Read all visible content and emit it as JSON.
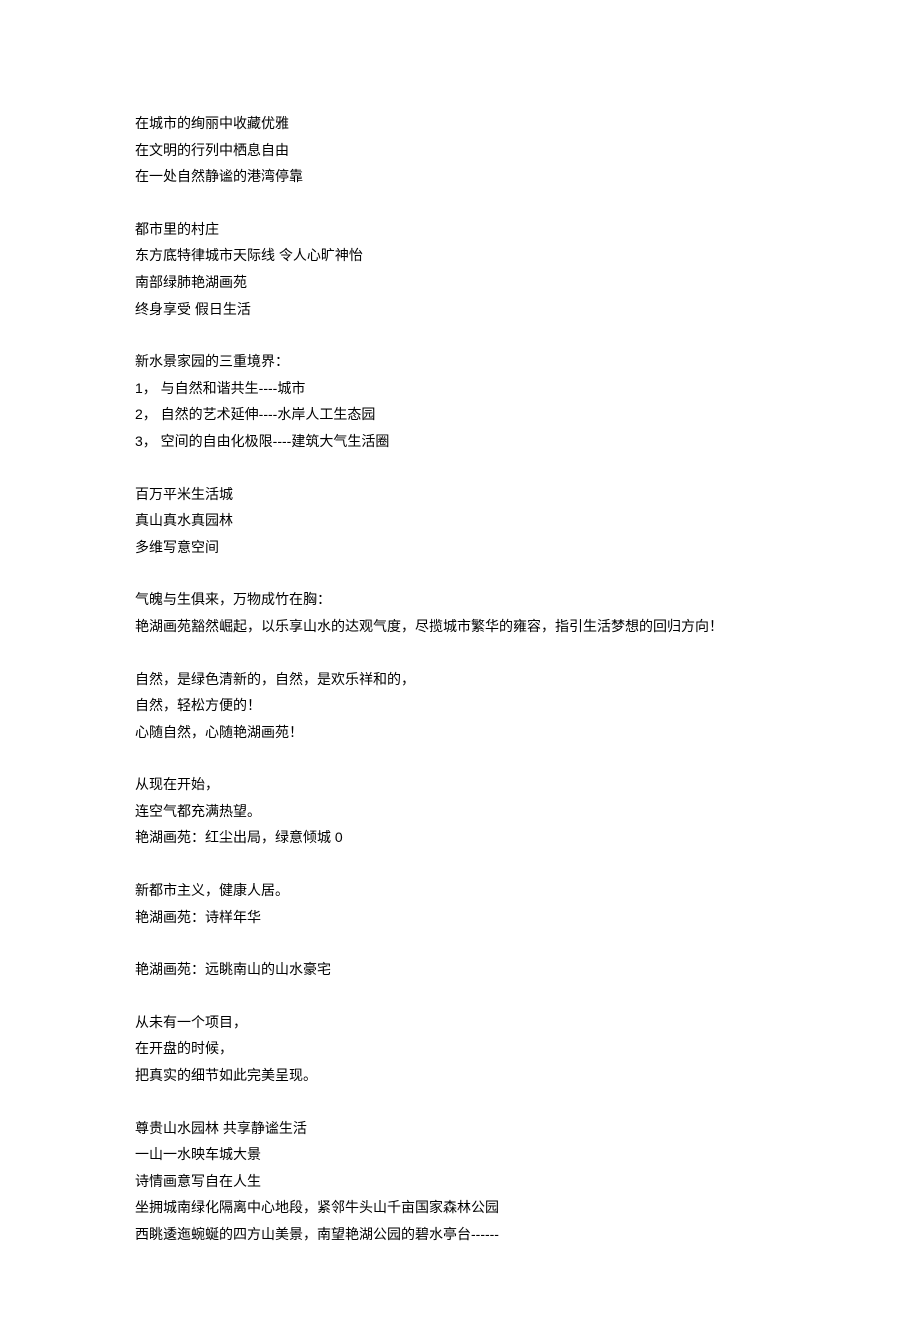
{
  "blocks": [
    {
      "lines": [
        "在城市的绚丽中收藏优雅",
        "在文明的行列中栖息自由",
        "在一处自然静谧的港湾停靠"
      ]
    },
    {
      "lines": [
        "都市里的村庄",
        "东方底特律城市天际线  令人心旷神怡",
        "南部绿肺艳湖画苑",
        "终身享受  假日生活"
      ]
    },
    {
      "lines": [
        "新水景家园的三重境界：",
        "1，   与自然和谐共生----城市",
        "2，   自然的艺术延伸----水岸人工生态园",
        "3，   空间的自由化极限----建筑大气生活圈"
      ]
    },
    {
      "lines": [
        "百万平米生活城",
        "真山真水真园林",
        "多维写意空间"
      ]
    },
    {
      "lines": [
        "气魄与生俱来，万物成竹在胸：",
        "艳湖画苑豁然崛起，以乐享山水的达观气度，尽揽城市繁华的雍容，指引生活梦想的回归方向！"
      ]
    },
    {
      "lines": [
        "自然，是绿色清新的，自然，是欢乐祥和的，",
        "自然，轻松方便的！",
        "心随自然，心随艳湖画苑！"
      ]
    },
    {
      "lines": [
        "从现在开始，",
        "连空气都充满热望。",
        "艳湖画苑：红尘出局，绿意倾城 0"
      ]
    },
    {
      "lines": [
        "新都市主义，健康人居。",
        "艳湖画苑：诗样年华"
      ]
    },
    {
      "lines": [
        "艳湖画苑：远眺南山的山水豪宅"
      ]
    },
    {
      "lines": [
        "从未有一个项目，",
        "在开盘的时候，",
        "把真实的细节如此完美呈现。"
      ]
    },
    {
      "lines": [
        "尊贵山水园林 共享静谧生活",
        "一山一水映车城大景",
        "诗情画意写自在人生",
        "坐拥城南绿化隔离中心地段，紧邻牛头山千亩国家森林公园",
        "西眺逶迤蜿蜒的四方山美景，南望艳湖公园的碧水亭台------"
      ]
    }
  ]
}
